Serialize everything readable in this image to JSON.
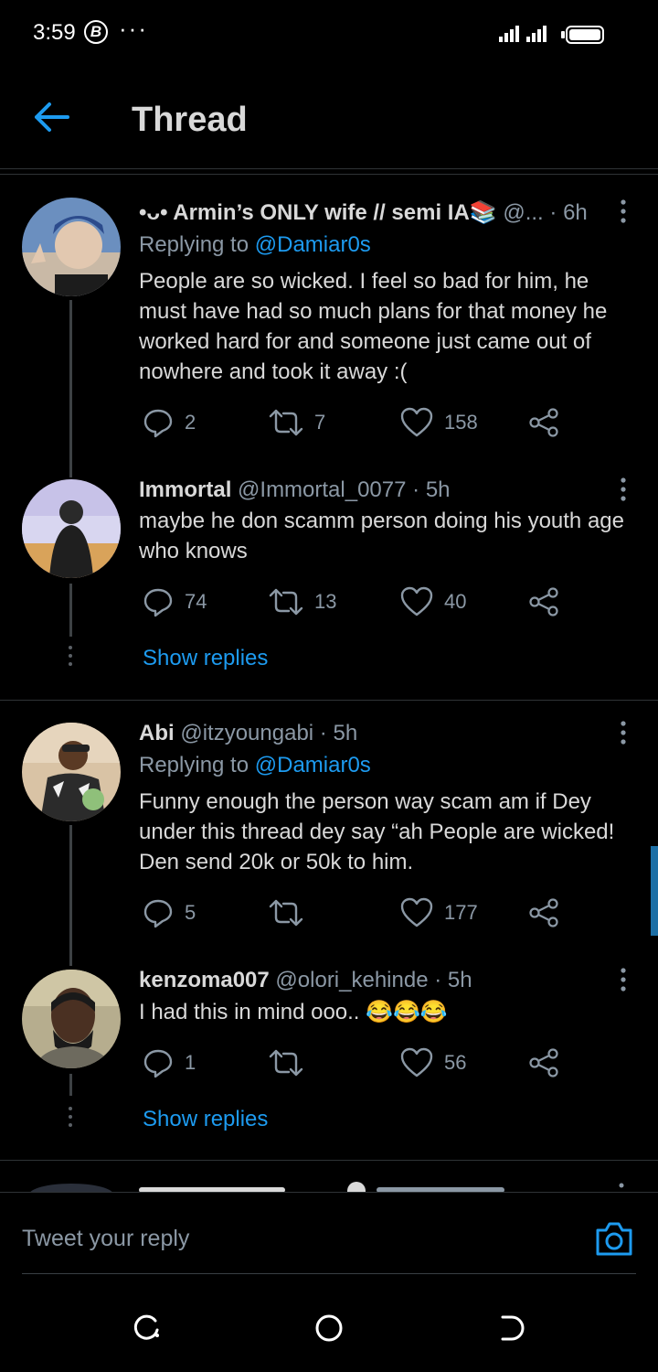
{
  "status_bar": {
    "time": "3:59",
    "b_badge": "B",
    "dots": "···"
  },
  "header": {
    "title": "Thread"
  },
  "tweets": [
    {
      "name": "•ᴗ• Armin’s ONLY wife // semi IA📚",
      "handle": "@...",
      "dot": "·",
      "time": "6h",
      "reply_prefix": "Replying to ",
      "reply_to": "@Damiar0s",
      "text": "People are so wicked. I feel so bad for him, he must have had so much plans for that money he worked hard for and someone just came out of nowhere and took it away :(",
      "replies": "2",
      "retweets": "7",
      "likes": "158"
    },
    {
      "name": "Immortal",
      "handle": "@Immortal_0077",
      "dot": "·",
      "time": "5h",
      "text": "maybe he don scamm person doing his youth age who knows",
      "replies": "74",
      "retweets": "13",
      "likes": "40"
    },
    {
      "name": "Abi",
      "handle": "@itzyoungabi",
      "dot": "·",
      "time": "5h",
      "reply_prefix": "Replying to ",
      "reply_to": "@Damiar0s",
      "text": "Funny enough the person way scam am if Dey under this thread dey say “ah People are wicked! Den send 20k or 50k to him.",
      "replies": "5",
      "retweets": "",
      "likes": "177"
    },
    {
      "name": "kenzoma007",
      "handle": "@olori_kehinde",
      "dot": "·",
      "time": "5h",
      "text": "I had this in mind ooo.. 😂😂😂",
      "replies": "1",
      "retweets": "",
      "likes": "56"
    }
  ],
  "show_replies_label": "Show replies",
  "composer": {
    "placeholder": "Tweet your reply"
  },
  "colors": {
    "accent": "#1d9bf0",
    "muted": "#8b98a5",
    "background": "#000000"
  }
}
